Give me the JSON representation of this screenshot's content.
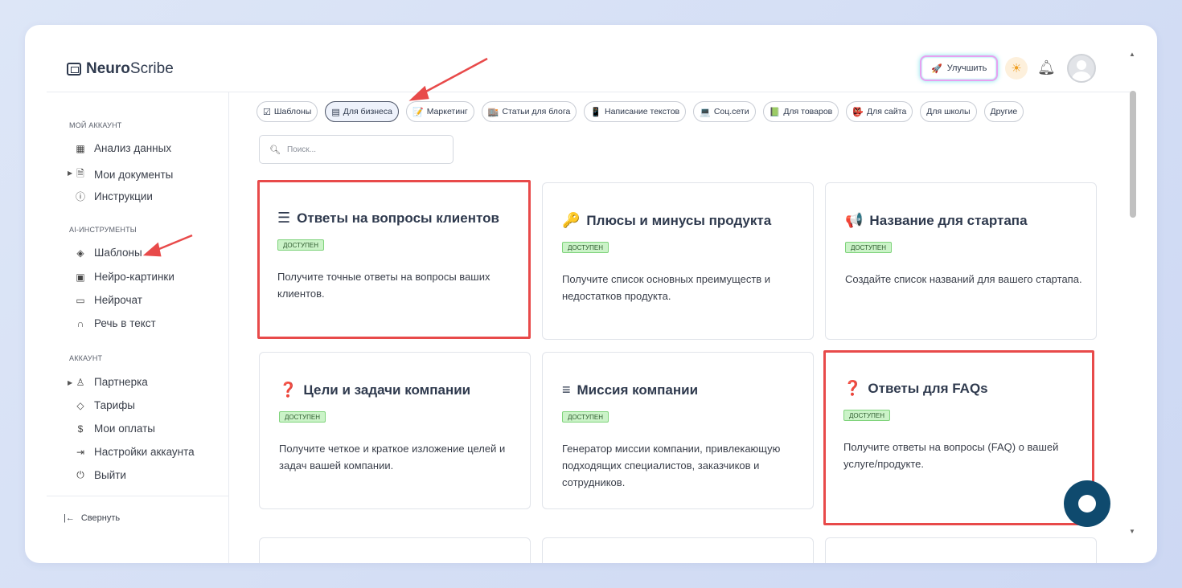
{
  "app": {
    "logo_bold": "Neuro",
    "logo_rest": "Scribe"
  },
  "header": {
    "upgrade_label": "Улучшить"
  },
  "sidebar": {
    "sections": [
      {
        "title": "МОЙ АККАУНТ"
      },
      {
        "title": "AI-ИНСТРУМЕНТЫ"
      },
      {
        "title": "АККАУНТ"
      }
    ],
    "items": [
      {
        "label": "Анализ данных",
        "icon": "grid-icon"
      },
      {
        "label": "Мои документы",
        "icon": "document-icon"
      },
      {
        "label": "Инструкции",
        "icon": "help-circle-icon"
      },
      {
        "label": "Шаблоны",
        "icon": "layers-icon"
      },
      {
        "label": "Нейро-картинки",
        "icon": "image-icon"
      },
      {
        "label": "Нейрочат",
        "icon": "chat-icon"
      },
      {
        "label": "Речь в текст",
        "icon": "headphones-icon"
      },
      {
        "label": "Партнерка",
        "icon": "users-icon"
      },
      {
        "label": "Тарифы",
        "icon": "tag-icon"
      },
      {
        "label": "Мои оплаты",
        "icon": "dollar-icon"
      },
      {
        "label": "Настройки аккаунта",
        "icon": "logout-arrow-icon"
      },
      {
        "label": "Выйти",
        "icon": "power-icon"
      }
    ],
    "collapse_label": "Свернуть"
  },
  "filters": [
    {
      "label": "Шаблоны",
      "icon": "checkbox-icon"
    },
    {
      "label": "Для бизнеса",
      "icon": "briefcase-icon",
      "active": true
    },
    {
      "label": "Маркетинг",
      "icon": "memo-icon"
    },
    {
      "label": "Статьи для блога",
      "icon": "blog-icon"
    },
    {
      "label": "Написание текстов",
      "icon": "phone-icon"
    },
    {
      "label": "Соц.сети",
      "icon": "laptop-icon"
    },
    {
      "label": "Для товаров",
      "icon": "book-icon"
    },
    {
      "label": "Для сайта",
      "icon": "mask-icon"
    },
    {
      "label": "Для школы",
      "icon": ""
    },
    {
      "label": "Другие",
      "icon": ""
    }
  ],
  "search": {
    "placeholder": "Поиск..."
  },
  "cards": [
    {
      "title": "Ответы на вопросы клиентов",
      "icon": "list-icon",
      "badge": "ДОСТУПЕН",
      "desc": "Получите точные ответы на вопросы ваших клиентов."
    },
    {
      "title": "Плюсы и минусы продукта",
      "icon": "key-icon",
      "badge": "ДОСТУПЕН",
      "desc": "Получите список основных преимуществ и недостатков продукта."
    },
    {
      "title": "Название для стартапа",
      "icon": "megaphone-icon",
      "badge": "ДОСТУПЕН",
      "desc": "Создайте список названий для вашего стартапа."
    },
    {
      "title": "Цели и задачи компании",
      "icon": "question-icon",
      "badge": "ДОСТУПЕН",
      "desc": "Получите четкое и краткое изложение целей и задач вашей компании."
    },
    {
      "title": "Миссия компании",
      "icon": "text-lines-icon",
      "badge": "ДОСТУПЕН",
      "desc": "Генератор миссии компании, привлекающую подходящих специалистов, заказчиков и сотрудников."
    },
    {
      "title": "Ответы для FAQs",
      "icon": "question-icon",
      "badge": "ДОСТУПЕН",
      "desc": "Получите ответы на вопросы (FAQ) о вашей услуге/продукте."
    }
  ],
  "colors": {
    "highlight": "#e84a4a",
    "badge_bg": "#cbf3c8",
    "fab": "#0f4a6e"
  }
}
